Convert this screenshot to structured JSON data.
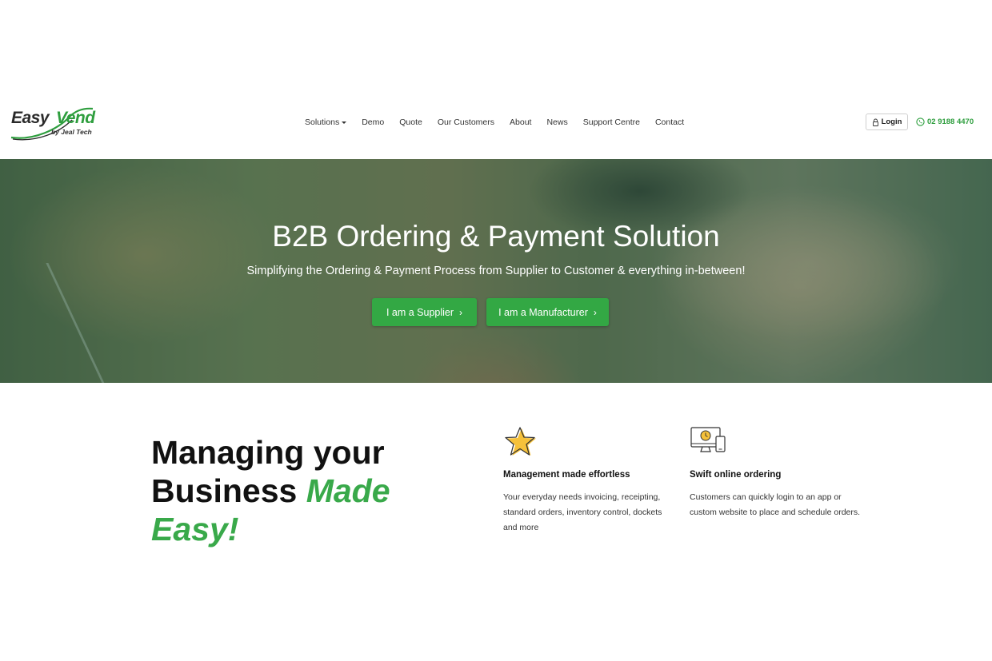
{
  "logo": {
    "word1": "Easy",
    "word2": "Vend",
    "byline": "by Jeal Tech"
  },
  "nav": {
    "items": [
      {
        "label": "Solutions",
        "dropdown": true
      },
      {
        "label": "Demo"
      },
      {
        "label": "Quote"
      },
      {
        "label": "Our Customers"
      },
      {
        "label": "About"
      },
      {
        "label": "News"
      },
      {
        "label": "Support Centre"
      },
      {
        "label": "Contact"
      }
    ]
  },
  "header": {
    "login_label": "Login",
    "login_icon": "lock-icon",
    "phone": "02 9188 4470",
    "phone_icon": "phone-icon"
  },
  "hero": {
    "title": "B2B Ordering & Payment Solution",
    "subtitle": "Simplifying the Ordering & Payment Process from Supplier to Customer & everything in-between!",
    "supplier_button": "I am a Supplier",
    "manufacturer_button": "I am a Manufacturer"
  },
  "intro": {
    "headline_line1": "Managing your",
    "headline_line2": "Business",
    "headline_accent_a": "Made",
    "headline_accent_b": "Easy!"
  },
  "features": [
    {
      "icon": "star-icon",
      "title": "Management made effortless",
      "text": "Your everyday needs invoicing, receipting, standard orders, inventory control, dockets and more"
    },
    {
      "icon": "devices-icon",
      "title": "Swift online ordering",
      "text": "Customers can quickly login to an app or custom website to place and schedule orders."
    }
  ],
  "colors": {
    "brand_green": "#33a844",
    "accent_green": "#39a94a",
    "text_dark": "#111111"
  }
}
